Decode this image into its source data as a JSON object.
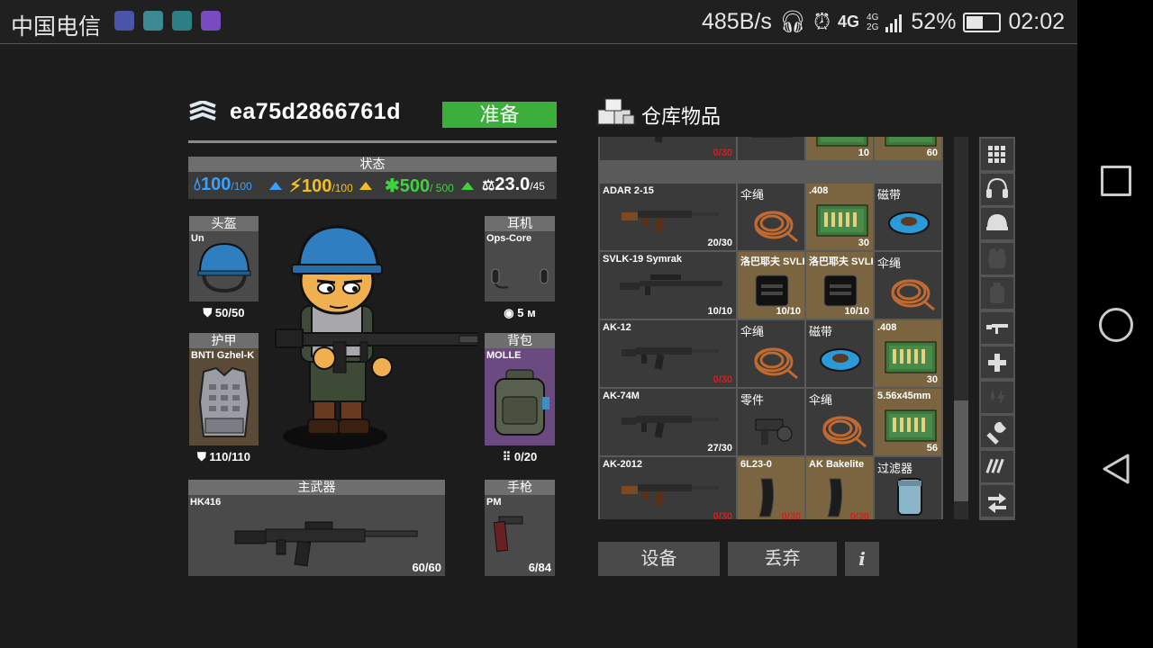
{
  "statusbar": {
    "carrier": "中国电信",
    "net_speed": "485B/s",
    "net_type": "4G",
    "signal_4g": "4G",
    "signal_2g": "2G",
    "battery_pct": "52%",
    "battery_level": 0.52,
    "time": "02:02"
  },
  "player": {
    "name": "ea75d2866761d",
    "ready_label": "准备"
  },
  "status": {
    "header": "状态",
    "water": {
      "value": "100",
      "max": "/100",
      "color": "#3aa0ff"
    },
    "energy": {
      "value": "100",
      "max": "/100",
      "color": "#f0c020"
    },
    "health": {
      "value": "500",
      "max": "/ 500",
      "color": "#40d040"
    },
    "weight": {
      "value": "23.0",
      "max": "/45",
      "color": "#ffffff"
    }
  },
  "equipment": {
    "helmet": {
      "title": "头盔",
      "name": "Un",
      "stat": "50/50"
    },
    "headset": {
      "title": "耳机",
      "name": "Ops-Core",
      "stat": "5 м"
    },
    "armor": {
      "title": "护甲",
      "name": "BNTI Gzhel-K",
      "stat": "110/110"
    },
    "backpack": {
      "title": "背包",
      "name": "MOLLE",
      "stat": "0/20"
    },
    "primary": {
      "title": "主武器",
      "name": "HK416",
      "stat": "60/60"
    },
    "pistol": {
      "title": "手枪",
      "name": "PM",
      "stat": "6/84"
    }
  },
  "warehouse": {
    "title": "仓库物品",
    "rows": [
      [
        {
          "name": "",
          "qty": "0/30",
          "qty_red": true,
          "kind": "rifle",
          "bg": "gray"
        },
        {
          "name": "",
          "qty": "",
          "qty_red": false,
          "kind": "tools",
          "bg": "gray"
        },
        {
          "name": "",
          "qty": "10",
          "qty_red": false,
          "kind": "ammo",
          "bg": "tan"
        },
        {
          "name": "",
          "qty": "60",
          "qty_red": false,
          "kind": "ammo",
          "bg": "tan"
        }
      ],
      [
        {
          "name": "ADAR 2-15",
          "qty": "20/30",
          "qty_red": false,
          "kind": "rifle-wood",
          "bg": "gray"
        },
        {
          "name": "伞绳",
          "qty": "",
          "qty_red": false,
          "kind": "rope",
          "bg": "gray"
        },
        {
          "name": ".408",
          "qty": "30",
          "qty_red": false,
          "kind": "ammo",
          "bg": "tan"
        },
        {
          "name": "磁带",
          "qty": "",
          "qty_red": false,
          "kind": "tape",
          "bg": "gray"
        }
      ],
      [
        {
          "name": "SVLK-19 Symrak",
          "qty": "10/10",
          "qty_red": false,
          "kind": "sniper",
          "bg": "gray"
        },
        {
          "name": "洛巴耶夫 SVLK",
          "qty": "10/10",
          "qty_red": false,
          "kind": "mag",
          "bg": "tan"
        },
        {
          "name": "洛巴耶夫 SVLK",
          "qty": "10/10",
          "qty_red": false,
          "kind": "mag",
          "bg": "tan"
        },
        {
          "name": "伞绳",
          "qty": "",
          "qty_red": false,
          "kind": "rope",
          "bg": "gray"
        }
      ],
      [
        {
          "name": "AK-12",
          "qty": "0/30",
          "qty_red": true,
          "kind": "rifle",
          "bg": "gray"
        },
        {
          "name": "伞绳",
          "qty": "",
          "qty_red": false,
          "kind": "rope",
          "bg": "gray"
        },
        {
          "name": "磁带",
          "qty": "",
          "qty_red": false,
          "kind": "tape",
          "bg": "gray"
        },
        {
          "name": ".408",
          "qty": "30",
          "qty_red": false,
          "kind": "ammo",
          "bg": "tan"
        }
      ],
      [
        {
          "name": "AK-74M",
          "qty": "27/30",
          "qty_red": false,
          "kind": "rifle",
          "bg": "gray"
        },
        {
          "name": "零件",
          "qty": "",
          "qty_red": false,
          "kind": "parts",
          "bg": "gray"
        },
        {
          "name": "伞绳",
          "qty": "",
          "qty_red": false,
          "kind": "rope",
          "bg": "gray"
        },
        {
          "name": "5.56x45mm",
          "qty": "56",
          "qty_red": false,
          "kind": "ammo",
          "bg": "tan"
        }
      ],
      [
        {
          "name": "AK-2012",
          "qty": "0/30",
          "qty_red": true,
          "kind": "rifle-wood",
          "bg": "gray"
        },
        {
          "name": "6L23-0",
          "qty": "0/30",
          "qty_red": true,
          "kind": "akmag",
          "bg": "tan"
        },
        {
          "name": "AK Bakelite",
          "qty": "0/30",
          "qty_red": true,
          "kind": "akmag",
          "bg": "tan"
        },
        {
          "name": "过滤器",
          "qty": "",
          "qty_red": false,
          "kind": "filter",
          "bg": "gray"
        }
      ]
    ]
  },
  "categories": [
    {
      "icon": "grid-icon",
      "enabled": true
    },
    {
      "icon": "headset-icon",
      "enabled": true
    },
    {
      "icon": "helmet-icon",
      "enabled": true
    },
    {
      "icon": "armor-icon",
      "enabled": false
    },
    {
      "icon": "backpack-icon",
      "enabled": false
    },
    {
      "icon": "rifle-icon",
      "enabled": true
    },
    {
      "icon": "medkit-icon",
      "enabled": true
    },
    {
      "icon": "consumables-icon",
      "enabled": false
    },
    {
      "icon": "wrench-icon",
      "enabled": true
    },
    {
      "icon": "ammo-icon",
      "enabled": true
    },
    {
      "icon": "swap-icon",
      "enabled": true
    }
  ],
  "actions": {
    "equip": "设备",
    "discard": "丢弃",
    "info": "i"
  }
}
